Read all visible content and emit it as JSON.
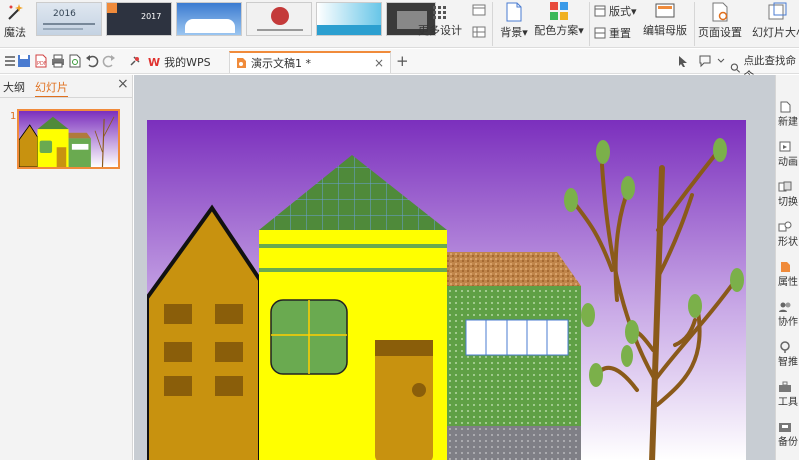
{
  "ribbon": {
    "magic_label": "魔法",
    "gallery_years": [
      "2016",
      "2017"
    ],
    "more_design_label": "更多设计",
    "background_label": "背景",
    "color_scheme_label": "配色方案",
    "layout_label": "版式",
    "reset_label": "重置",
    "edit_master_label": "编辑母版",
    "page_setup_label": "页面设置",
    "slide_size_label": "幻灯片大小"
  },
  "tabs": {
    "wps_label": "我的WPS",
    "doc_label": "演示文稿1 *"
  },
  "search_label": "点此查找命令",
  "left_pane": {
    "outline_label": "大纲",
    "slides_label": "幻灯片",
    "slide_number": "1"
  },
  "right_rail": [
    {
      "label": "新建",
      "icon": "new-icon"
    },
    {
      "label": "动画",
      "icon": "animation-icon"
    },
    {
      "label": "切换",
      "icon": "transition-icon"
    },
    {
      "label": "形状",
      "icon": "shape-icon"
    },
    {
      "label": "属性",
      "icon": "property-icon"
    },
    {
      "label": "协作",
      "icon": "collab-icon"
    },
    {
      "label": "智推",
      "icon": "smart-icon"
    },
    {
      "label": "工具",
      "icon": "tool-icon"
    },
    {
      "label": "备份",
      "icon": "backup-icon"
    }
  ],
  "colors": {
    "accent": "#f08b3b",
    "sky_top": "#7b2fbd",
    "sky_bottom": "#ffffff",
    "house_brown": "#c8920f",
    "house_yellow": "#ffff00",
    "roof_green": "#4f8a3a",
    "house_green": "#6aaa50",
    "tree_brown": "#8a5a1a",
    "leaf_green": "#7bb04a"
  }
}
